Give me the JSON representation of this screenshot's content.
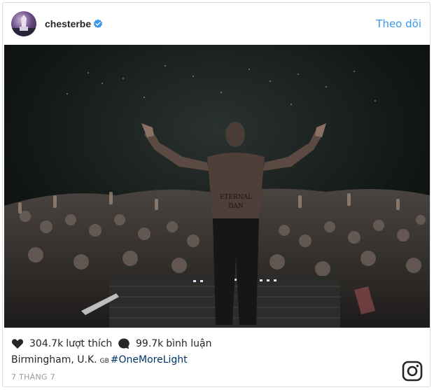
{
  "header": {
    "username": "chesterbe",
    "follow_label": "Theo dõi"
  },
  "post": {
    "likes_count": "304.7k",
    "likes_label": "lượt thích",
    "comments_count": "99.7k",
    "comments_label": "bình luận",
    "location": "Birmingham, U.K.",
    "country_code": "GB",
    "hashtag": "#OneMoreLight",
    "date": "7 THÁNG 7"
  },
  "photo": {
    "tattoo_text_1": "ETERNAL",
    "tattoo_text_2": "DAN"
  },
  "colors": {
    "accent": "#3897f0",
    "hashtag": "#003569",
    "text": "#262626",
    "muted": "#999999",
    "verified": "#3897f0"
  },
  "icons": [
    "verified-badge-icon",
    "heart-icon",
    "comment-icon",
    "instagram-logo-icon"
  ]
}
